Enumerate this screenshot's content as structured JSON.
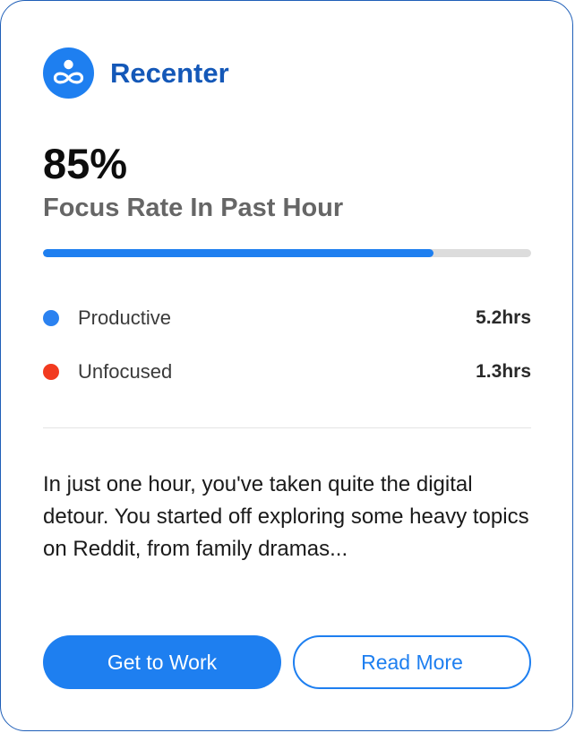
{
  "app": {
    "name": "Recenter",
    "logo_icon": "person-infinity-icon",
    "accent_color": "#1e7ff0"
  },
  "focus": {
    "value": "85%",
    "label": "Focus Rate In Past Hour",
    "progress_fraction": 0.8
  },
  "stats": [
    {
      "label": "Productive",
      "value": "5.2hrs",
      "color": "#2b82f0"
    },
    {
      "label": "Unfocused",
      "value": "1.3hrs",
      "color": "#f23a1f"
    }
  ],
  "summary": "In just one hour, you've taken quite the digital detour. You started off exploring some heavy topics on Reddit, from family dramas...",
  "actions": {
    "primary_label": "Get to Work",
    "secondary_label": "Read More"
  }
}
